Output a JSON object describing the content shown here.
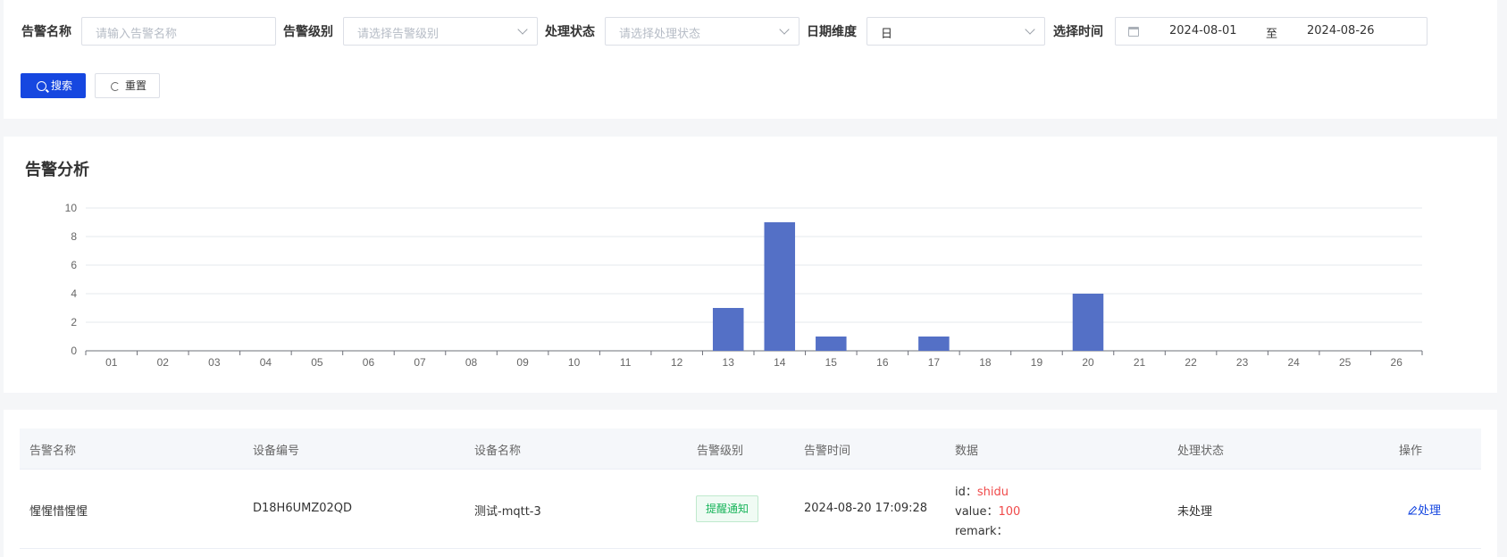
{
  "filters": {
    "alarm_name": {
      "label": "告警名称",
      "placeholder": "请输入告警名称"
    },
    "alarm_level": {
      "label": "告警级别",
      "placeholder": "请选择告警级别"
    },
    "status": {
      "label": "处理状态",
      "placeholder": "请选择处理状态"
    },
    "date_dim": {
      "label": "日期维度",
      "value": "日"
    },
    "time_range": {
      "label": "选择时间",
      "start": "2024-08-01",
      "sep": "至",
      "end": "2024-08-26"
    }
  },
  "buttons": {
    "search": "搜索",
    "reset": "重置"
  },
  "icons": {
    "search": "search-icon",
    "reset": "refresh-icon",
    "calendar": "calendar-icon",
    "dropdown": "chevron-down-icon",
    "handle": "edit-icon"
  },
  "colors": {
    "primary": "#1647e0",
    "bar": "#5470c6",
    "tag_green": "#18b45a",
    "value_red": "#f04a4a"
  },
  "chart": {
    "title": "告警分析"
  },
  "chart_data": {
    "type": "bar",
    "categories": [
      "01",
      "02",
      "03",
      "04",
      "05",
      "06",
      "07",
      "08",
      "09",
      "10",
      "11",
      "12",
      "13",
      "14",
      "15",
      "16",
      "17",
      "18",
      "19",
      "20",
      "21",
      "22",
      "23",
      "24",
      "25",
      "26"
    ],
    "values": [
      0,
      0,
      0,
      0,
      0,
      0,
      0,
      0,
      0,
      0,
      0,
      0,
      3,
      9,
      1,
      0,
      1,
      0,
      0,
      4,
      0,
      0,
      0,
      0,
      0,
      0
    ],
    "yticks": [
      0,
      2,
      4,
      6,
      8,
      10
    ],
    "ylim": [
      0,
      10
    ],
    "grid": true
  },
  "table": {
    "headers": [
      "告警名称",
      "设备编号",
      "设备名称",
      "告警级别",
      "告警时间",
      "数据",
      "处理状态",
      "操作"
    ],
    "row": {
      "name": "惺惺惜惺惺",
      "device_no": "D18H6UMZ02QD",
      "device_name": "测试-mqtt-3",
      "level": "提醒通知",
      "time": "2024-08-20 17:09:28",
      "data_id_key": "id：",
      "data_id_val": "shidu",
      "data_value_key": "value：",
      "data_value_val": "100",
      "data_remark_key": "remark：",
      "status": "未处理",
      "action": "处理"
    }
  }
}
